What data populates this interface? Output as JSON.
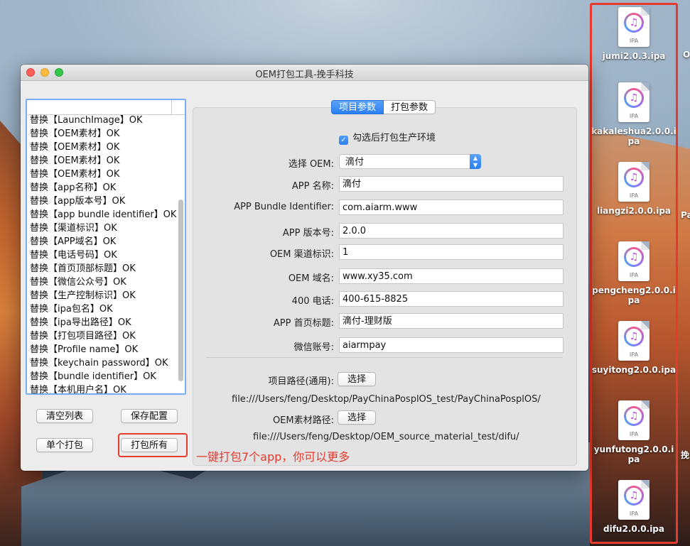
{
  "window": {
    "title": "OEM打包工具-挽手科技"
  },
  "log": {
    "items": [
      "替换【LaunchImage】OK",
      "替换【OEM素材】OK",
      "替换【OEM素材】OK",
      "替换【OEM素材】OK",
      "替换【OEM素材】OK",
      "替换【app名称】OK",
      "替换【app版本号】OK",
      "替换【app bundle identifier】OK",
      "替换【渠道标识】OK",
      "替换【APP域名】OK",
      "替换【电话号码】OK",
      "替换【首页顶部标题】OK",
      "替换【微信公众号】OK",
      "替换【生产控制标识】OK",
      "替换【ipa包名】OK",
      "替换【ipa导出路径】OK",
      "替换【打包项目路径】OK",
      "替换【Profile name】OK",
      "替换【keychain password】OK",
      "替换【bundle identifier】OK",
      "替换【本机用户名】OK"
    ]
  },
  "buttons": {
    "clear": "清空列表",
    "save": "保存配置",
    "single": "单个打包",
    "all": "打包所有",
    "choose": "选择"
  },
  "annotation": "一键打包7个app，你可以更多",
  "tabs": [
    "项目参数",
    "打包参数"
  ],
  "form": {
    "checkbox_label": "勾选后打包生产环境",
    "oem_label": "选择 OEM:",
    "oem_value": "滴付",
    "fields": [
      {
        "label": "APP 名称:",
        "value": "滴付"
      },
      {
        "label": "APP Bundle Identifier:",
        "value": "com.aiarm.www"
      },
      {
        "label": "APP 版本号:",
        "value": "2.0.0"
      },
      {
        "label": "OEM 渠道标识:",
        "value": "1"
      },
      {
        "label": "OEM 域名:",
        "value": "www.xy35.com"
      },
      {
        "label": "400 电话:",
        "value": "400-615-8825"
      },
      {
        "label": "APP 首页标题:",
        "value": "滴付-理财版"
      },
      {
        "label": "微信账号:",
        "value": "aiarmpay"
      }
    ],
    "project_path_label": "项目路径(通用):",
    "project_path": "file:///Users/feng/Desktop/PayChinaPosplOS_test/PayChinaPosplOS/",
    "material_path_label": "OEM素材路径:",
    "material_path": "file:///Users/feng/Desktop/OEM_source_material_test/difu/"
  },
  "desktop": {
    "icon_badge": "IPA",
    "files": [
      "jumi2.0.3.ipa",
      "kakaleshua2.0.0.ipa",
      "liangzi2.0.0.ipa",
      "pengcheng2.0.0.ipa",
      "suyitong2.0.0.ipa",
      "yunfutong2.0.0.ipa",
      "difu2.0.0.ipa"
    ],
    "peeks": [
      "O",
      "Pa",
      "挽"
    ]
  }
}
